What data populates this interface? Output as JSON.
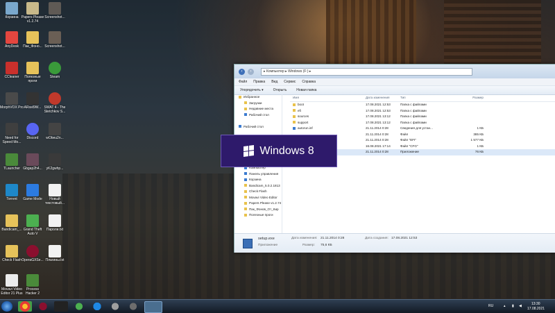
{
  "desktop_icons": [
    {
      "label": "Корзина",
      "color": "#7aa8cc"
    },
    {
      "label": "Papers Please v1.2.74",
      "color": "#c8b98a"
    },
    {
      "label": "Screenshot...",
      "color": "#5f5a55"
    },
    {
      "label": "AnyDesk",
      "color": "#e4463f"
    },
    {
      "label": "Пак_Фоно...",
      "color": "#e6c25a"
    },
    {
      "label": "Screenshot...",
      "color": "#6a5f55"
    },
    {
      "label": "CCleaner",
      "color": "#c9302c"
    },
    {
      "label": "Полезные проги",
      "color": "#e6c25a"
    },
    {
      "label": "Steam",
      "color": "#3a9a3a"
    },
    {
      "label": "MorphVOX Pro",
      "color": "#4a4a4a"
    },
    {
      "label": "ARxel9W...",
      "color": "#333333"
    },
    {
      "label": "SWAT 4 - The Stetchkov S...",
      "color": "#c0392b"
    },
    {
      "label": "Need for Speed Mo...",
      "color": "#3f3f3f"
    },
    {
      "label": "Discord",
      "color": "#5865f2"
    },
    {
      "label": "wObeu2n...",
      "color": "#444444"
    },
    {
      "label": "TLauncher",
      "color": "#4a8a3a"
    },
    {
      "label": "Gbgap2h4...",
      "color": "#6a4a5a"
    },
    {
      "label": "yK2gwhp...",
      "color": "#3a3a3a"
    },
    {
      "label": "Torrent",
      "color": "#1e88c9"
    },
    {
      "label": "Game Mode",
      "color": "#2c7be0"
    },
    {
      "label": "Новый текстовый...",
      "color": "#f2f2f2"
    },
    {
      "label": "Bandicam_...",
      "color": "#e6c25a"
    },
    {
      "label": "Grand Theft Auto V",
      "color": "#4caf50"
    },
    {
      "label": "Пароли.txt",
      "color": "#f2f2f2"
    },
    {
      "label": "Check Flash",
      "color": "#e6c25a"
    },
    {
      "label": "OperaGXSe...",
      "color": "#8b0f2e"
    },
    {
      "label": "Плагины.txt",
      "color": "#f2f2f2"
    },
    {
      "label": "Movavi Video Editor 21 Plus",
      "color": "#ececec"
    },
    {
      "label": "Process Hacker 2",
      "color": "#4a8a3a"
    }
  ],
  "explorer": {
    "address": "▸ Компьютер ▸ Windows (F:) ▸",
    "menu": [
      "Файл",
      "Правка",
      "Вид",
      "Сервис",
      "Справка"
    ],
    "toolbar": [
      "Упорядочить ▾",
      "Открыть",
      "Новая папка"
    ],
    "nav": [
      {
        "label": "Избранное",
        "sub": false,
        "icon": "star-icon"
      },
      {
        "label": "Загрузки",
        "sub": true,
        "icon": "folder-icon"
      },
      {
        "label": "Недавние места",
        "sub": true,
        "icon": "folder-icon"
      },
      {
        "label": "Рабочий стол",
        "sub": true,
        "icon": "monitor-icon"
      },
      {
        "label": "",
        "sub": false,
        "icon": "none"
      },
      {
        "label": "Рабочий стол",
        "sub": false,
        "icon": "monitor-icon"
      },
      {
        "label": "",
        "sub": false,
        "icon": "none"
      },
      {
        "label": "",
        "sub": false,
        "icon": "none"
      },
      {
        "label": "",
        "sub": false,
        "icon": "none"
      },
      {
        "label": "",
        "sub": false,
        "icon": "none"
      },
      {
        "label": "",
        "sub": false,
        "icon": "none"
      },
      {
        "label": "Vityahaha",
        "sub": true,
        "icon": "user-icon"
      },
      {
        "label": "Компьютер",
        "sub": true,
        "icon": "computer-icon"
      },
      {
        "label": "Панель управления",
        "sub": true,
        "icon": "panel-icon"
      },
      {
        "label": "Корзина",
        "sub": true,
        "icon": "bin-icon"
      },
      {
        "label": "Bandicam_5.0.2.1813",
        "sub": true,
        "icon": "folder-icon"
      },
      {
        "label": "Check Flash",
        "sub": true,
        "icon": "folder-icon"
      },
      {
        "label": "Movavi Video Editor",
        "sub": true,
        "icon": "folder-icon"
      },
      {
        "label": "Papers Please v1.2.74",
        "sub": true,
        "icon": "folder-icon"
      },
      {
        "label": "Пак_Фонов_От_Кир",
        "sub": true,
        "icon": "folder-icon"
      },
      {
        "label": "Полезные проги",
        "sub": true,
        "icon": "folder-icon"
      }
    ],
    "columns": {
      "name": "Имя",
      "date": "Дата изменения",
      "type": "Тип",
      "size": "Размер"
    },
    "files": [
      {
        "name": "boot",
        "date": "17.08.2021 12:53",
        "type": "Папка с файлами",
        "size": ""
      },
      {
        "name": "efi",
        "date": "17.08.2021 12:53",
        "type": "Папка с файлами",
        "size": ""
      },
      {
        "name": "sources",
        "date": "17.08.2021 13:12",
        "type": "Папка с файлами",
        "size": ""
      },
      {
        "name": "support",
        "date": "17.08.2021 13:12",
        "type": "Папка с файлами",
        "size": ""
      },
      {
        "name": "autorun.inf",
        "date": "21.11.2014 0:28",
        "type": "Сведения для устан...",
        "size": "1 КБ"
      },
      {
        "name": "",
        "date": "21.11.2014 0:28",
        "type": "Файл",
        "size": "385 КБ"
      },
      {
        "name": "",
        "date": "21.11.2014 0:28",
        "type": "Файл \"EFI\"",
        "size": "1 577 КБ"
      },
      {
        "name": "",
        "date": "16.08.2021 17:14",
        "type": "Файл \"CFG\"",
        "size": "1 КБ"
      },
      {
        "name": "",
        "date": "21.11.2014 0:28",
        "type": "Приложение",
        "size": "76 КБ"
      }
    ],
    "details": {
      "filename": "setup.exe",
      "filetype": "Приложение",
      "modified_label": "Дата изменения:",
      "modified_value": "21.11.2014 0:28",
      "created_label": "Дата создания:",
      "created_value": "17.08.2021 12:53",
      "size_label": "Размер:",
      "size_value": "75,6 КБ"
    }
  },
  "win8_popup": {
    "text": "Windows 8"
  },
  "taskbar": {
    "lang": "RU",
    "time": "13:30",
    "date": "17.08.2021"
  }
}
